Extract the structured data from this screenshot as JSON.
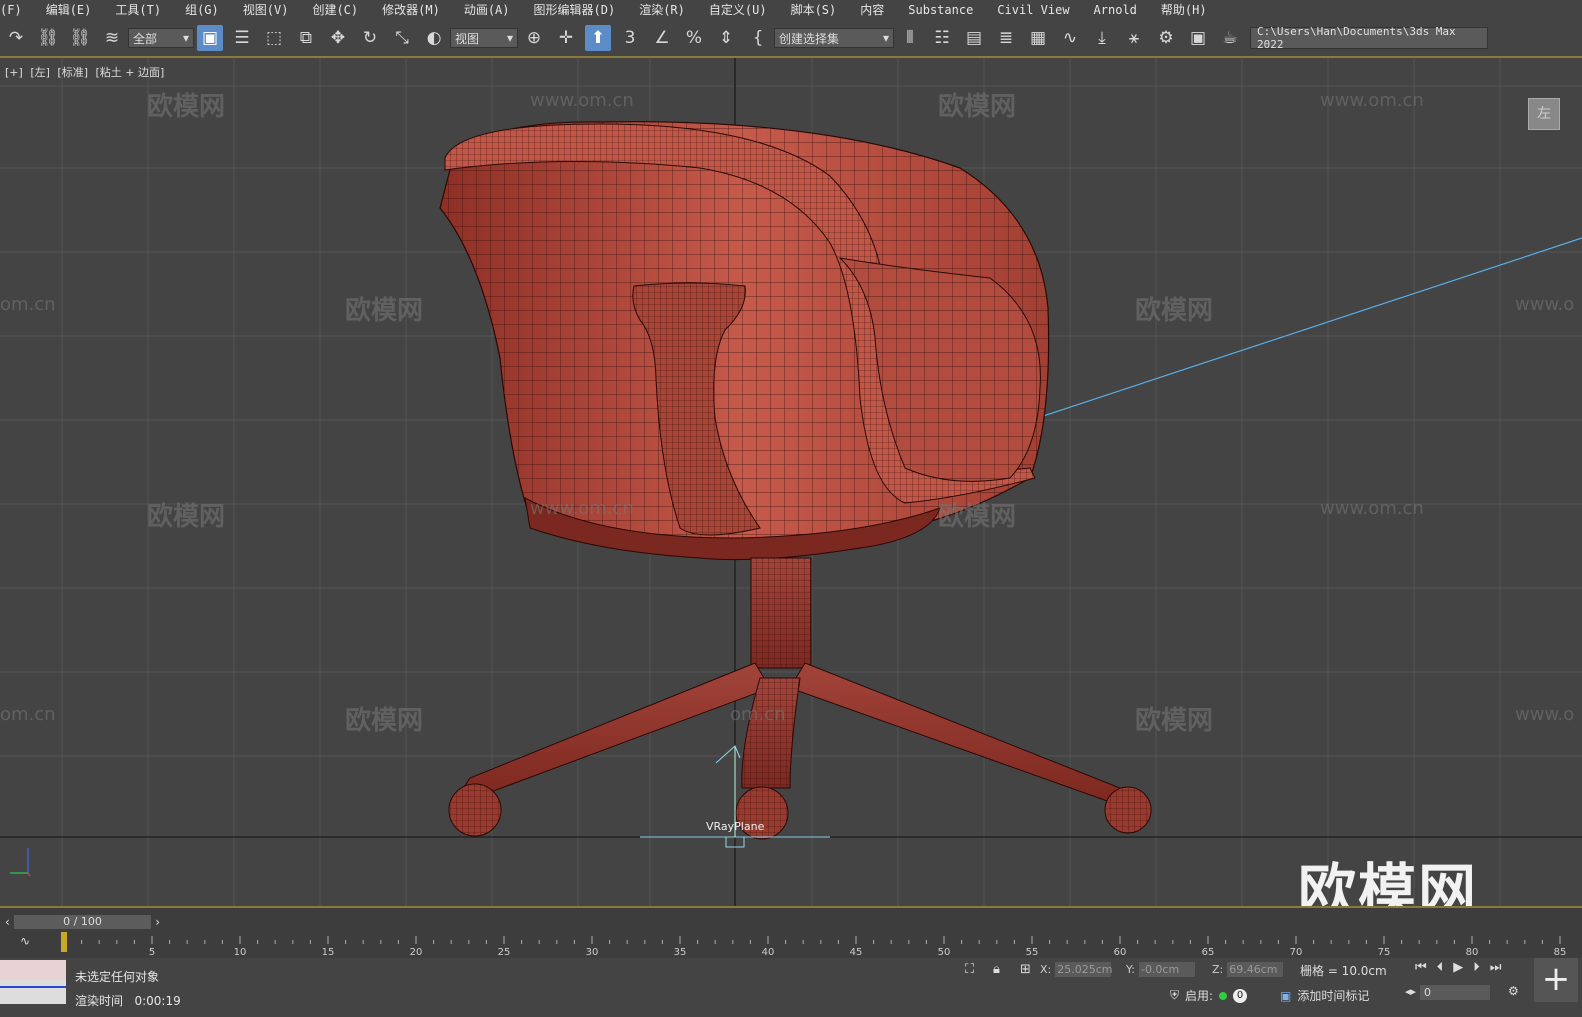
{
  "menu": [
    "(F)",
    "编辑(E)",
    "工具(T)",
    "组(G)",
    "视图(V)",
    "创建(C)",
    "修改器(M)",
    "动画(A)",
    "图形编辑器(D)",
    "渲染(R)",
    "自定义(U)",
    "脚本(S)",
    "内容",
    "Substance",
    "Civil View",
    "Arnold",
    "帮助(H)"
  ],
  "toolbar": {
    "filter_dropdown": "全部",
    "ref_coord_dropdown": "视图",
    "selection_set_dropdown": "创建选择集",
    "project_path": "C:\\Users\\Han\\Documents\\3ds Max 2022"
  },
  "viewport": {
    "label_parts": [
      "[+]",
      "[左]",
      "[标准]",
      "[粘土 + 边面]"
    ],
    "viewcube_label": "左",
    "object_label": "VRayPlane",
    "watermark_text": "欧模网",
    "watermark_url": "www.om.cn",
    "watermark_url_partial": "om.cn",
    "watermark_url_partial_right": "www.o",
    "brand_logo": "欧模网"
  },
  "timeline": {
    "frame_counter": "0 / 100",
    "ticks": [
      "5",
      "10",
      "15",
      "20",
      "25",
      "30",
      "35",
      "40",
      "45",
      "50",
      "55",
      "60",
      "65",
      "70",
      "75",
      "80",
      "85"
    ]
  },
  "status": {
    "message": "未选定任何对象",
    "render_time_label": "渲染时间",
    "render_time_value": "0:00:19",
    "x_label": "X:",
    "x_value": "25.025cm",
    "y_label": "Y:",
    "y_value": "-0.0cm",
    "z_label": "Z:",
    "z_value": "69.46cm",
    "grid": "栅格 = 10.0cm",
    "enable_label": "启用:",
    "enable_count": "0",
    "add_time_tag": "添加时间标记",
    "current_frame": "0"
  },
  "colors": {
    "accent": "#8a7a3e",
    "active_tool": "#5b8cc7",
    "chair": "#b5493c",
    "wire": "#3a0f0c",
    "helper_line": "#5aaee8"
  }
}
